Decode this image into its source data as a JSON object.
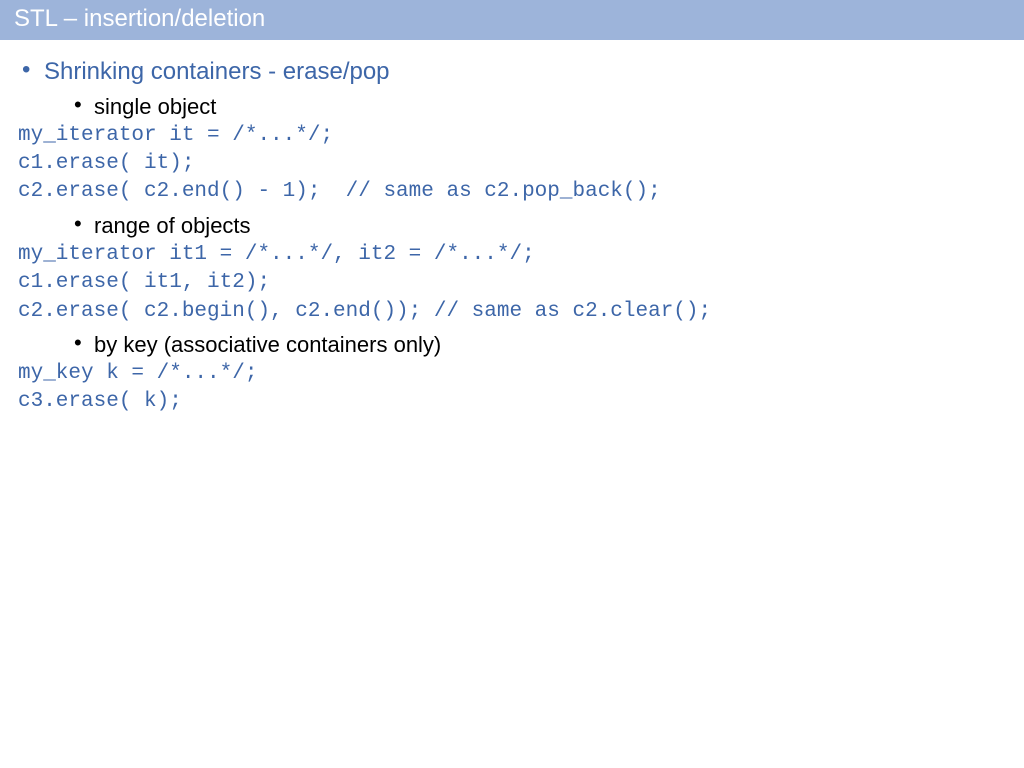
{
  "title": "STL – insertion/deletion",
  "heading": "Shrinking containers - erase/pop",
  "sections": [
    {
      "subheading": "single object",
      "code": "my_iterator it = /*...*/;\nc1.erase( it);\nc2.erase( c2.end() - 1);  // same as c2.pop_back();"
    },
    {
      "subheading": "range of objects",
      "code": "my_iterator it1 = /*...*/, it2 = /*...*/;\nc1.erase( it1, it2);\nc2.erase( c2.begin(), c2.end()); // same as c2.clear();"
    },
    {
      "subheading": "by key (associative containers only)",
      "code": "my_key k = /*...*/;\nc3.erase( k);"
    }
  ]
}
